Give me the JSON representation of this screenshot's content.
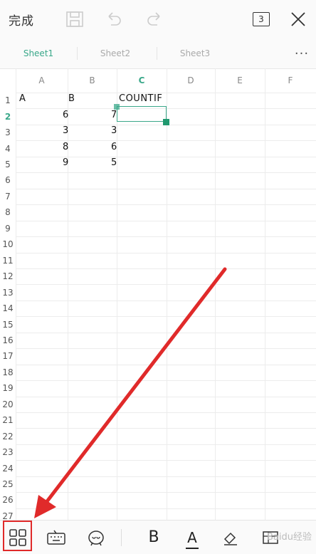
{
  "topbar": {
    "done_label": "完成",
    "pages_count": "3",
    "icons": [
      "save-icon",
      "undo-icon",
      "redo-icon",
      "pages-icon",
      "close-icon"
    ]
  },
  "tabs": {
    "items": [
      {
        "label": "Sheet1",
        "active": true
      },
      {
        "label": "Sheet2",
        "active": false
      },
      {
        "label": "Sheet3",
        "active": false
      }
    ],
    "more_label": "···"
  },
  "grid": {
    "columns": [
      "A",
      "B",
      "C",
      "D",
      "E",
      "F"
    ],
    "active_column": "C",
    "rows": [
      "1",
      "2",
      "3",
      "4",
      "5",
      "6",
      "7",
      "8",
      "9",
      "10",
      "11",
      "12",
      "13",
      "14",
      "15",
      "16",
      "17",
      "18",
      "19",
      "20",
      "21",
      "22",
      "23",
      "24",
      "25",
      "26",
      "27"
    ],
    "active_row": "2",
    "cells": {
      "A1": "A",
      "B1": "B",
      "C1": "COUNTIF",
      "B2": "6",
      "C2": "7",
      "B3": "3",
      "C3": "3",
      "B4": "8",
      "C4": "6",
      "B5": "9",
      "C5": "5"
    },
    "selected_cell": "C2"
  },
  "bottombar": {
    "icons": [
      "apps-grid-icon",
      "keyboard-icon",
      "format-icon",
      "bold-icon",
      "font-color-icon",
      "clear-format-icon",
      "table-icon"
    ],
    "bold_label": "B",
    "font_color_label": "A",
    "highlighted": "apps-grid-icon",
    "watermark": "Baidu经验"
  },
  "colors": {
    "accent": "#3aa88a",
    "annotation": "#e02a2a"
  }
}
